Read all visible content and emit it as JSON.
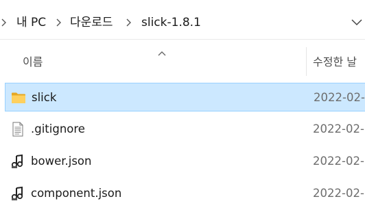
{
  "breadcrumb": {
    "items": [
      "내 PC",
      "다운로드",
      "slick-1.8.1"
    ]
  },
  "columns": {
    "name": "이름",
    "date": "수정한 날"
  },
  "files": [
    {
      "name": "slick",
      "date": "2022-02-",
      "icon": "folder-icon",
      "selected": true
    },
    {
      "name": ".gitignore",
      "date": "2022-02-",
      "icon": "text-file-icon",
      "selected": false
    },
    {
      "name": "bower.json",
      "date": "2022-02-",
      "icon": "json-file-icon",
      "selected": false
    },
    {
      "name": "component.json",
      "date": "2022-02-",
      "icon": "json-file-icon",
      "selected": false
    }
  ],
  "colors": {
    "selection_fill": "#cce8ff",
    "selection_border": "#99d1ff",
    "folder": "#ffd05e"
  }
}
